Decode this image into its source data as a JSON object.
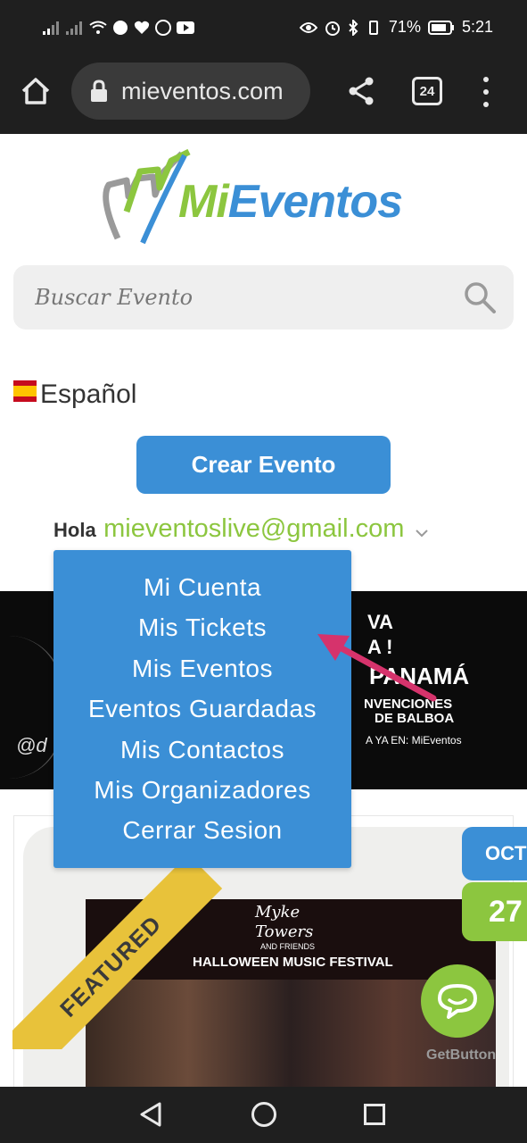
{
  "status_bar": {
    "battery": "71%",
    "time": "5:21"
  },
  "browser": {
    "url": "mieventos.com",
    "tab_count": "24"
  },
  "site": {
    "logo": {
      "part1": "Mi",
      "part2": "Eventos"
    },
    "search_placeholder": "Buscar Evento",
    "language": "Español",
    "create_button": "Crear Evento",
    "greeting": "Hola",
    "user_email": "mieventoslive@gmail.com"
  },
  "user_menu": {
    "items": [
      {
        "label": "Mi Cuenta"
      },
      {
        "label": "Mis Tickets"
      },
      {
        "label": "Mis Eventos"
      },
      {
        "label": "Eventos Guardadas"
      },
      {
        "label": "Mis Contactos"
      },
      {
        "label": "Mis Organizadores"
      },
      {
        "label": "Cerrar Sesion"
      }
    ]
  },
  "banner": {
    "line1": "VA",
    "line2": "A !",
    "line3": "PANAMÁ",
    "line4": "NVENCIONES",
    "line5": "DE BALBOA",
    "line6": "A YA EN: MiEventos",
    "line7": "@d"
  },
  "event_card": {
    "featured_label": "FEATURED",
    "month": "OCT",
    "day": "27",
    "poster": {
      "headline1": "Myke",
      "headline2": "Towers",
      "headline3": "AND FRIENDS",
      "headline4": "HALLOWEEN MUSIC FESTIVAL"
    }
  },
  "chat_widget": {
    "label": "GetButton"
  },
  "colors": {
    "brand_blue": "#3b8fd6",
    "brand_green": "#8cc63f",
    "featured_yellow": "#e8c23a",
    "annotation_arrow": "#d6336c"
  }
}
